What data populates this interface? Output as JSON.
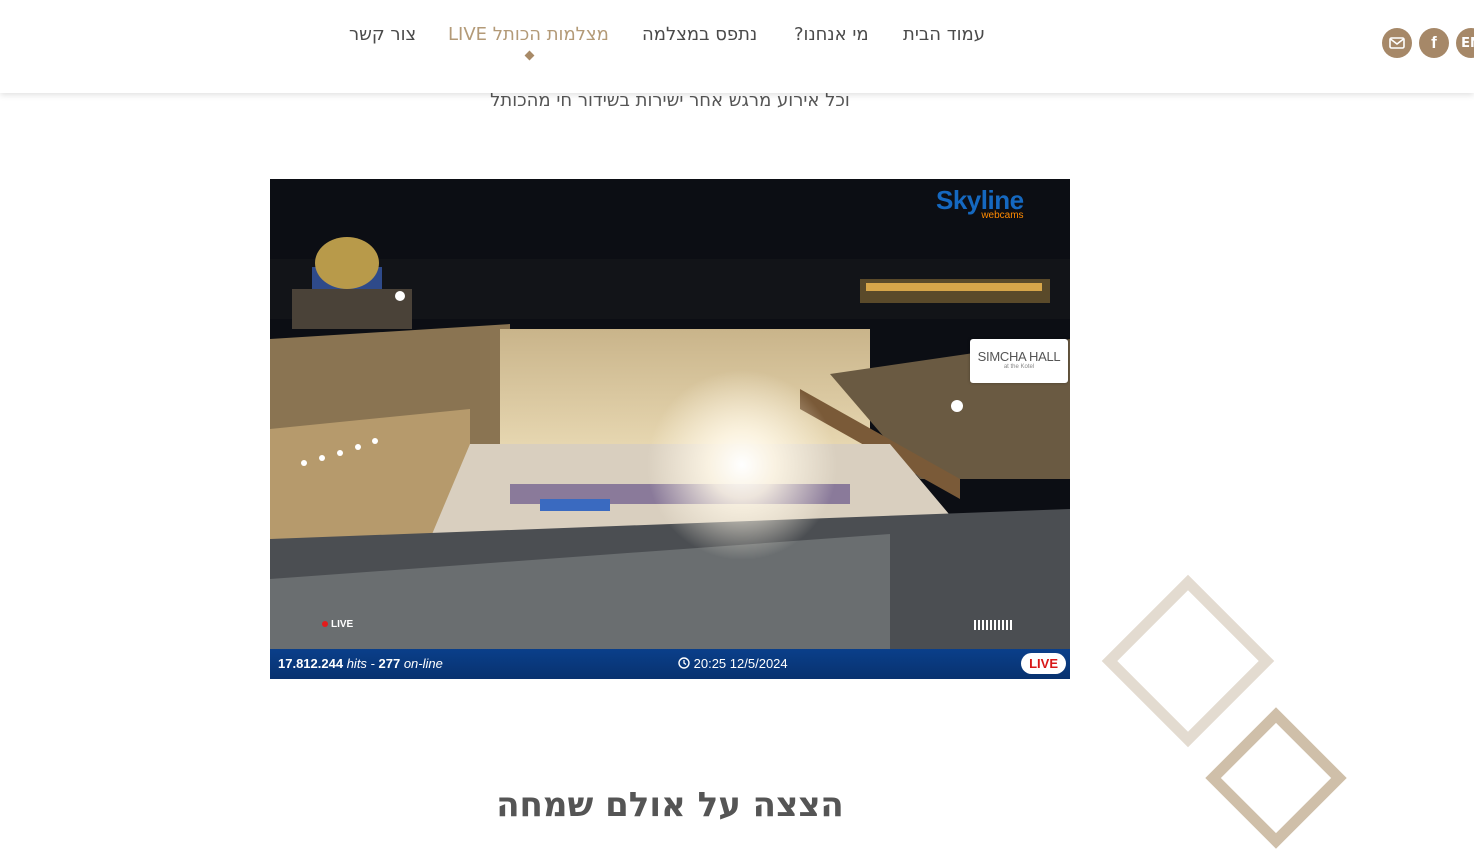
{
  "nav": {
    "items": [
      {
        "label": "עמוד הבית"
      },
      {
        "label": "מי אנחנו?"
      },
      {
        "label": "נתפס במצלמה"
      },
      {
        "label": "מצלמות הכותל LIVE",
        "active": true
      },
      {
        "label": "צור קשר"
      }
    ]
  },
  "social": {
    "email_icon": "mail-icon",
    "facebook_icon": "facebook-icon",
    "lang_label": "EN"
  },
  "subtitle": "וכל אירוע מרגש אחר ישירות בשידור חי מהכותל",
  "camera": {
    "brand_main": "Skyline",
    "brand_sub": "webcams",
    "overlay_label": "SIMCHA HALL",
    "overlay_sub": "at the Kotel",
    "live_small": "LIVE",
    "hits_count": "17.812.244",
    "hits_label": "hits -",
    "online_count": "277",
    "online_label": "on-line",
    "time": "20:25",
    "date": "12/5/2024",
    "live_badge": "LIVE"
  },
  "section_heading": "הצצה על אולם שמחה",
  "colors": {
    "accent": "#a68868",
    "active_nav": "#b39a77",
    "cam_bar": "#0a3f8a",
    "live_red": "#d81818"
  }
}
